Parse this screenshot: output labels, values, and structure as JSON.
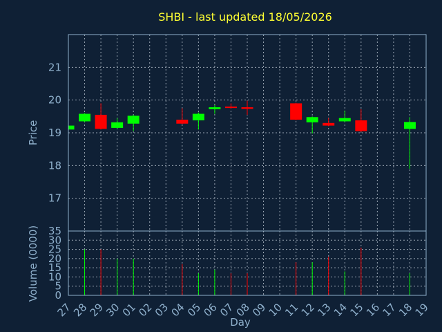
{
  "chart_data": {
    "type": "candlestick",
    "title": "SHBI - last updated 18/05/2026",
    "xlabel": "Day",
    "ylabel_price": "Price",
    "ylabel_volume": "Volume (0000)",
    "colors": {
      "up": "#00ff00",
      "down": "#ff0000",
      "background": "#0f2035",
      "text": "#8fb0cc",
      "title": "#ffff33"
    },
    "grid": true,
    "price_ylim": [
      16,
      22
    ],
    "price_ticks": [
      "17",
      "18",
      "19",
      "20",
      "21"
    ],
    "volume_ylim": [
      0,
      35
    ],
    "volume_ticks": [
      "0",
      "5",
      "10",
      "15",
      "20",
      "25",
      "30",
      "35"
    ],
    "x_ticks": [
      "27",
      "28",
      "29",
      "30",
      "01",
      "02",
      "03",
      "04",
      "05",
      "06",
      "07",
      "08",
      "09",
      "10",
      "11",
      "12",
      "13",
      "14",
      "15",
      "16",
      "17",
      "18",
      "19"
    ],
    "candles": [
      {
        "day": "27",
        "open": 19.1,
        "close": 19.22,
        "high": 19.22,
        "low": 19.1,
        "volume": 0
      },
      {
        "day": "28",
        "open": 19.35,
        "close": 19.58,
        "high": 19.6,
        "low": 19.33,
        "volume": 25
      },
      {
        "day": "29",
        "open": 19.55,
        "close": 19.12,
        "high": 19.9,
        "low": 19.1,
        "volume": 25
      },
      {
        "day": "30",
        "open": 19.15,
        "close": 19.32,
        "high": 19.45,
        "low": 19.13,
        "volume": 20
      },
      {
        "day": "01",
        "open": 19.28,
        "close": 19.52,
        "high": 19.55,
        "low": 19.05,
        "volume": 20
      },
      {
        "day": "04",
        "open": 19.4,
        "close": 19.28,
        "high": 19.75,
        "low": 19.26,
        "volume": 17
      },
      {
        "day": "05",
        "open": 19.38,
        "close": 19.58,
        "high": 19.62,
        "low": 19.1,
        "volume": 12
      },
      {
        "day": "06",
        "open": 19.72,
        "close": 19.78,
        "high": 19.85,
        "low": 19.58,
        "volume": 14
      },
      {
        "day": "07",
        "open": 19.8,
        "close": 19.76,
        "high": 19.9,
        "low": 19.74,
        "volume": 12
      },
      {
        "day": "08",
        "open": 19.78,
        "close": 19.73,
        "high": 19.98,
        "low": 19.55,
        "volume": 12
      },
      {
        "day": "11",
        "open": 19.9,
        "close": 19.4,
        "high": 19.92,
        "low": 19.38,
        "volume": 18
      },
      {
        "day": "12",
        "open": 19.32,
        "close": 19.48,
        "high": 19.5,
        "low": 18.98,
        "volume": 18
      },
      {
        "day": "13",
        "open": 19.3,
        "close": 19.22,
        "high": 19.45,
        "low": 19.2,
        "volume": 21
      },
      {
        "day": "14",
        "open": 19.35,
        "close": 19.45,
        "high": 19.68,
        "low": 19.33,
        "volume": 13
      },
      {
        "day": "15",
        "open": 19.38,
        "close": 19.05,
        "high": 19.72,
        "low": 19.03,
        "volume": 26
      },
      {
        "day": "18",
        "open": 19.12,
        "close": 19.33,
        "high": 19.48,
        "low": 17.9,
        "volume": 12
      }
    ]
  }
}
